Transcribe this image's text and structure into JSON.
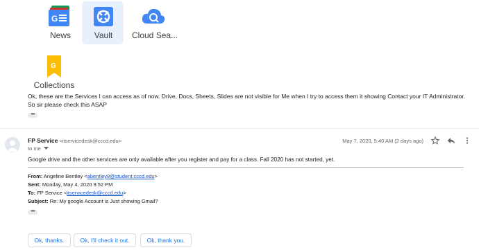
{
  "apps": [
    {
      "label": "News",
      "icon": "google-news-icon"
    },
    {
      "label": "Vault",
      "icon": "vault-icon"
    },
    {
      "label": "Cloud Sea...",
      "icon": "cloud-search-icon"
    },
    {
      "label": "Collections",
      "icon": "collections-icon"
    }
  ],
  "previous_message": {
    "line1": "Ok, these are the Services I can access as of now. Drive, Docs, Sheets, Slides are not visible for Me when I try to access them it showing Contact your IT Administrator.",
    "line2": "So sir please check this ASAP"
  },
  "email": {
    "sender_name": "FP Service",
    "sender_address": "<itservicedesk@cccd.edu>",
    "to_line": "to me",
    "date": "May 7, 2020, 5:40 AM (2 days ago)",
    "body": "Google drive and the other services are only available after you register and pay for a class. Fall 2020 has not started, yet.",
    "quoted": {
      "from_label": "From:",
      "from_name": "Angeline Bentley <",
      "from_email": "abentley8@student.cccd.edu",
      "from_close": ">",
      "sent_label": "Sent:",
      "sent_value": "Monday, May 4, 2020 9:52 PM",
      "to_label": "To:",
      "to_name": "FP Service <",
      "to_email": "itservicedesk@cccd.edu",
      "to_close": ">",
      "subject_label": "Subject:",
      "subject_value": "Re: My google Account is Just showing Gmail?"
    }
  },
  "smart_replies": [
    "Ok, thanks.",
    "Ok, I'll check it out.",
    "Ok, thank you."
  ],
  "colors": {
    "accent": "#1a73e8",
    "vault_bg": "#e8f0fe"
  }
}
